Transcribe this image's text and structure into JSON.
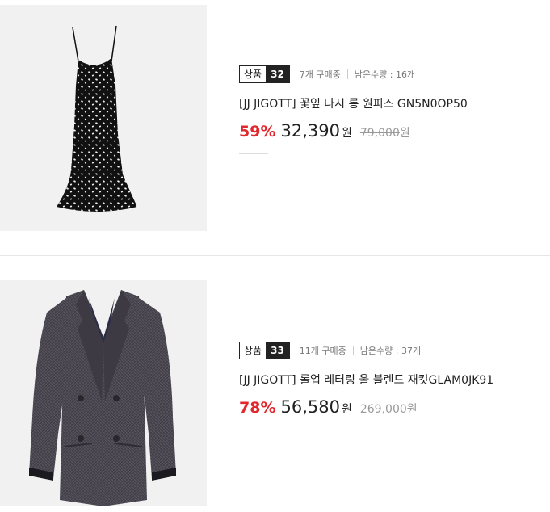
{
  "products": [
    {
      "badge_label": "상품",
      "badge_number": "32",
      "buying": "7개 구매중",
      "remaining": "남은수량 : 16개",
      "title": "[JJ JIGOTT] 꽃잎 나시 롱 원피스 GN5N0OP50",
      "discount": "59%",
      "price": "32,390",
      "currency": "원",
      "original_price": "79,000",
      "original_currency": "원",
      "image": "dress-image"
    },
    {
      "badge_label": "상품",
      "badge_number": "33",
      "buying": "11개 구매중",
      "remaining": "남은수량 : 37개",
      "title": "[JJ JIGOTT] 롤업 레터링 울 블렌드 재킷GLAM0JK91",
      "discount": "78%",
      "price": "56,580",
      "currency": "원",
      "original_price": "269,000",
      "original_currency": "원",
      "image": "jacket-image"
    }
  ],
  "colors": {
    "discount": "#e0282e",
    "thumb_bg": "#f1f1f1",
    "badge_dark": "#222222"
  }
}
